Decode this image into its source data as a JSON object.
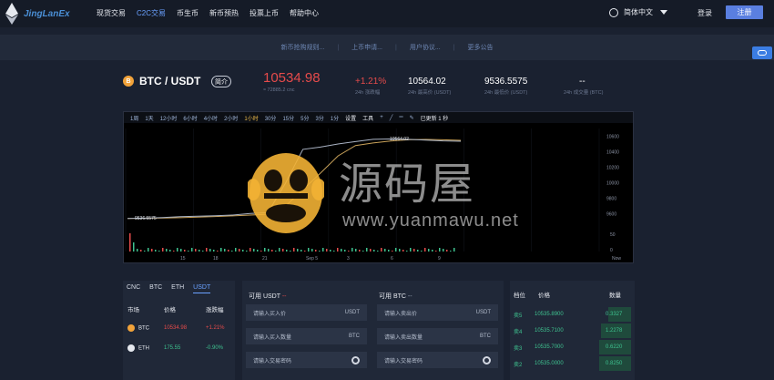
{
  "header": {
    "logo_text": "JingLanEx",
    "nav": [
      "现货交易",
      "C2C交易",
      "币生币",
      "新币预热",
      "投票上币",
      "帮助中心"
    ],
    "nav_active_index": 1,
    "language": "简体中文",
    "login": "登录",
    "register": "注册"
  },
  "notices": [
    "新币抢购规则...",
    "上币申请...",
    "用户协议...",
    "更多公告"
  ],
  "ticker": {
    "coin_symbol": "B",
    "pair": "BTC / USDT",
    "intro_label": "简介",
    "last_price": "10534.98",
    "last_price_cny": "≈ 72885.2 cnc",
    "change": "+1.21%",
    "change_label": "24h 涨跌幅",
    "high": "10564.02",
    "high_label": "24h 最高价 (USDT)",
    "low": "9536.5575",
    "low_label": "24h 最低价 (USDT)",
    "volume": "--",
    "volume_label": "24h 成交量 (BTC)"
  },
  "chart_toolbar": {
    "periods": [
      "1周",
      "1天",
      "12小时",
      "6小时",
      "4小时",
      "2小时",
      "1小时",
      "30分",
      "15分",
      "5分",
      "3分",
      "1分"
    ],
    "active_period": "1小时",
    "settings": "设置",
    "tools": "工具",
    "refresh_label": "已更新 1 秒"
  },
  "chart_data": {
    "type": "line",
    "x_ticks": [
      "15",
      "18",
      "21",
      "Sep 5",
      "3",
      "6",
      "9",
      "Now"
    ],
    "y_ticks": [
      "10600",
      "10400",
      "10200",
      "10000",
      "9800",
      "9600"
    ],
    "volume_ticks": [
      "50",
      "0"
    ],
    "price_label_high": "10564.02",
    "price_label_low": "9536.5575",
    "series": [
      {
        "values": [
          9536,
          9540,
          9548,
          9560,
          9565,
          9572,
          9580,
          9600,
          9610,
          9990,
          10430,
          10460,
          10500,
          10530,
          10560,
          10564,
          10560,
          10550,
          10540,
          10535
        ]
      }
    ],
    "ylim": [
      9450,
      10700
    ]
  },
  "watermark": {
    "cn_text": "源码屋",
    "url_text": "www.yuanmawu.net"
  },
  "market_panel": {
    "tabs": [
      "CNC",
      "BTC",
      "ETH",
      "USDT"
    ],
    "active_tab": "USDT",
    "headers": [
      "市场",
      "价格",
      "涨跌幅"
    ],
    "rows": [
      {
        "coin": "BTC",
        "icon": "B",
        "price": "10534.98",
        "change": "+1.21%",
        "color": "#e64b4b"
      },
      {
        "coin": "ETH",
        "icon": "E",
        "price": "175.55",
        "change": "-0.90%",
        "color": "#3ec28f"
      }
    ]
  },
  "trade_form": {
    "buy_available": "可用 USDT",
    "buy_available_value": "--",
    "sell_available": "可用 BTC",
    "sell_available_value": "--",
    "buy_price_placeholder": "请输入买入价",
    "buy_price_unit": "USDT",
    "buy_amount_placeholder": "请输入买入数量",
    "buy_amount_unit": "BTC",
    "buy_password_placeholder": "请输入交易密码",
    "sell_price_placeholder": "请输入卖出价",
    "sell_price_unit": "USDT",
    "sell_amount_placeholder": "请输入卖出数量",
    "sell_amount_unit": "BTC",
    "sell_password_placeholder": "请输入交易密码"
  },
  "order_book": {
    "headers": [
      "档位",
      "价格",
      "数量"
    ],
    "rows": [
      {
        "level": "卖5",
        "price": "10535.8900",
        "amount": "0.3327",
        "depth": 0.42
      },
      {
        "level": "卖4",
        "price": "10535.7100",
        "amount": "1.2278",
        "depth": 0.55
      },
      {
        "level": "卖3",
        "price": "10535.7000",
        "amount": "0.6220",
        "depth": 0.58
      },
      {
        "level": "卖2",
        "price": "10535.0000",
        "amount": "0.8250",
        "depth": 0.58
      }
    ]
  },
  "colors": {
    "up": "#e64b4b",
    "down": "#3ec28f",
    "accent": "#5a7fe0"
  }
}
